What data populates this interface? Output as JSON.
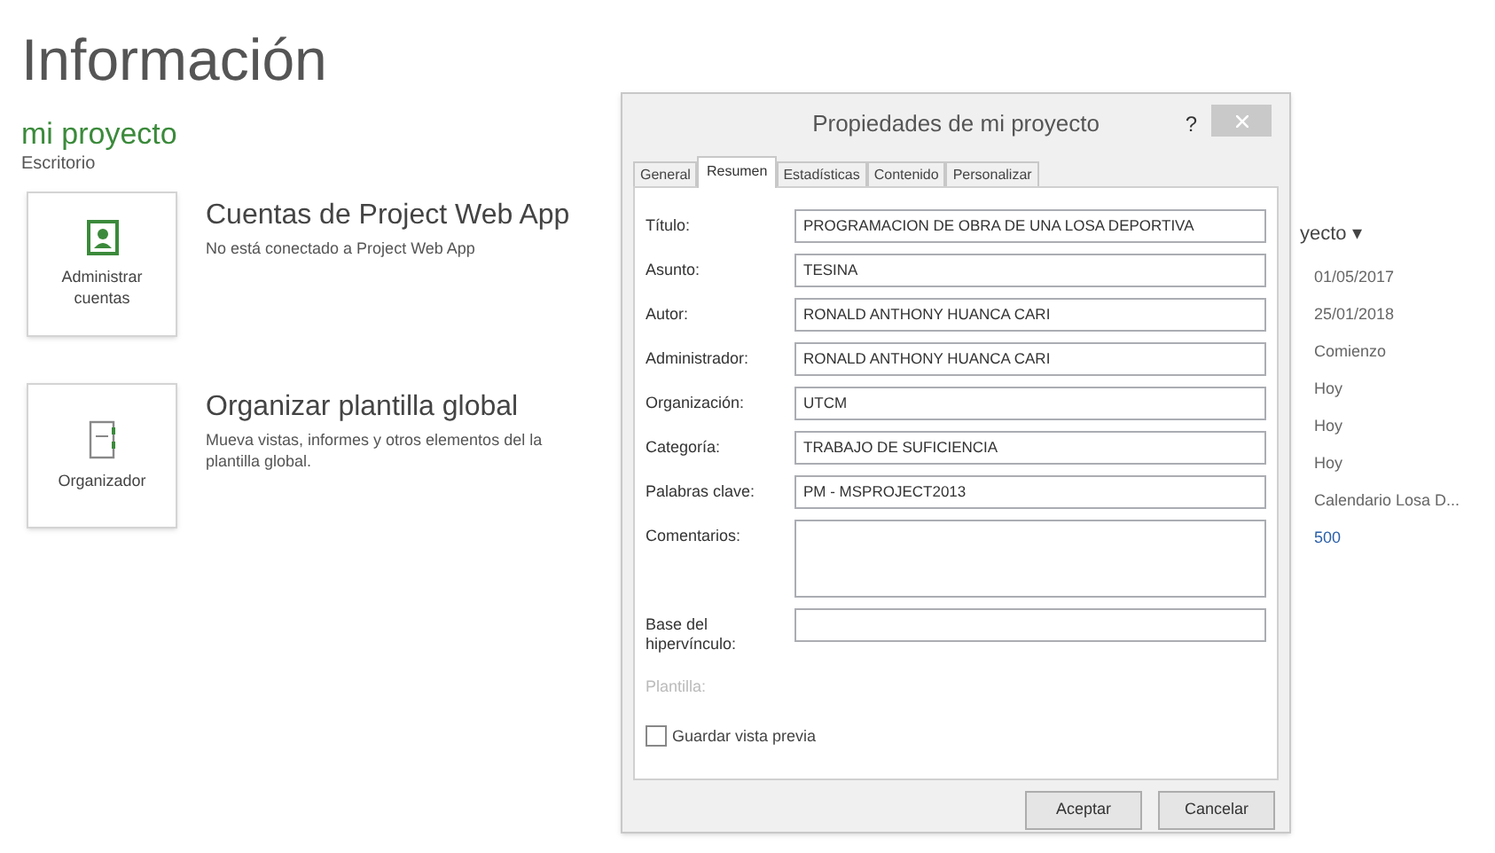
{
  "page": {
    "title": "Información",
    "project": "mi proyecto",
    "location": "Escritorio"
  },
  "cards": [
    {
      "kind": "account",
      "button": "Administrar cuentas",
      "title": "Cuentas de Project Web App",
      "description": "No está conectado a Project Web App"
    },
    {
      "kind": "organizer",
      "button": "Organizador",
      "title": "Organizar plantilla global",
      "description": "Mueva vistas, informes y otros elementos del la plantilla global."
    }
  ],
  "properties": {
    "heading": "yecto ▾",
    "values": [
      {
        "text": "01/05/2017",
        "kind": "plain"
      },
      {
        "text": "25/01/2018",
        "kind": "plain"
      },
      {
        "text": "Comienzo",
        "kind": "plain"
      },
      {
        "text": "Hoy",
        "kind": "plain"
      },
      {
        "text": "Hoy",
        "kind": "plain"
      },
      {
        "text": "Hoy",
        "kind": "plain"
      },
      {
        "text": "Calendario Losa D...",
        "kind": "plain"
      },
      {
        "text": "500",
        "kind": "link"
      }
    ]
  },
  "dialog": {
    "title": "Propiedades de mi proyecto",
    "help": "?",
    "tabs": [
      {
        "label": "General",
        "selected": false
      },
      {
        "label": "Resumen",
        "selected": true
      },
      {
        "label": "Estadísticas",
        "selected": false
      },
      {
        "label": "Contenido",
        "selected": false
      },
      {
        "label": "Personalizar",
        "selected": false
      }
    ],
    "fields": [
      {
        "label": "Título:",
        "value": "PROGRAMACION DE OBRA DE UNA LOSA DEPORTIVA",
        "kind": "line"
      },
      {
        "label": "Asunto:",
        "value": "TESINA",
        "kind": "line"
      },
      {
        "label": "Autor:",
        "value": "RONALD ANTHONY HUANCA CARI",
        "kind": "line"
      },
      {
        "label": "Administrador:",
        "value": "RONALD ANTHONY HUANCA CARI",
        "kind": "line"
      },
      {
        "label": "Organización:",
        "value": "UTCM",
        "kind": "line"
      },
      {
        "label": "Categoría:",
        "value": "TRABAJO DE SUFICIENCIA",
        "kind": "line"
      },
      {
        "label": "Palabras clave:",
        "value": "PM - MSPROJECT2013",
        "kind": "line"
      },
      {
        "label": "Comentarios:",
        "kind": "area"
      },
      {
        "label": "Base del hipervínculo:",
        "kind": "line"
      }
    ],
    "template_label": "Plantilla:",
    "preview": {
      "label": "Guardar vista previa",
      "checked": false
    },
    "buttons": [
      "Aceptar",
      "Cancelar"
    ]
  }
}
